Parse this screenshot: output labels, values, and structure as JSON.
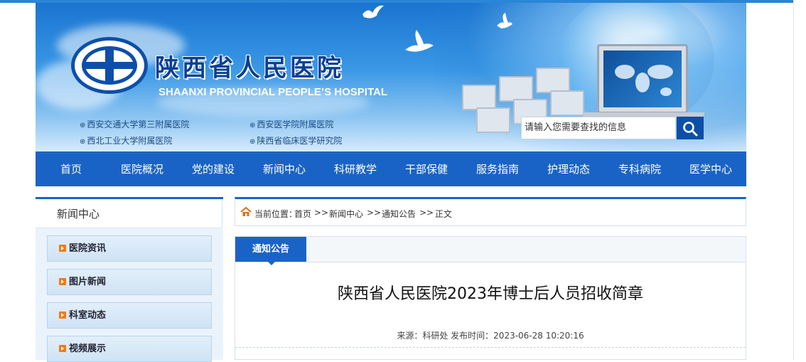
{
  "header": {
    "hospital_name": "陕西省人民医院",
    "hospital_name_en": "SHAANXI PROVINCIAL PEOPLE’S HOSPITAL",
    "affiliations": [
      "西安交通大学第三附属医院",
      "西安医学院附属医院",
      "西北工业大学附属医院",
      "陕西省临床医学研究院"
    ],
    "affiliation_bullet": "⊕",
    "search_placeholder": "请输入您需要查找的信息"
  },
  "nav": {
    "items": [
      "首页",
      "医院概况",
      "党的建设",
      "新闻中心",
      "科研教学",
      "干部保健",
      "服务指南",
      "护理动态",
      "专科病院",
      "医学中心"
    ]
  },
  "sidebar": {
    "title": "新闻中心",
    "items": [
      "医院资讯",
      "图片新闻",
      "科室动态",
      "视频展示"
    ]
  },
  "breadcrumb": {
    "prefix": "当前位置：",
    "items": [
      "首页",
      "新闻中心",
      "通知公告",
      "正文"
    ],
    "separator": ">>"
  },
  "content": {
    "tab_label": "通知公告",
    "title": "陕西省人民医院2023年博士后人员招收简章",
    "meta": "来源：科研处 发布时间：2023-06-28 10:20:16"
  },
  "colors": {
    "nav_bg": "#1a63c6",
    "brand_blue": "#0d4fa8",
    "accent_orange": "#f07a12"
  }
}
